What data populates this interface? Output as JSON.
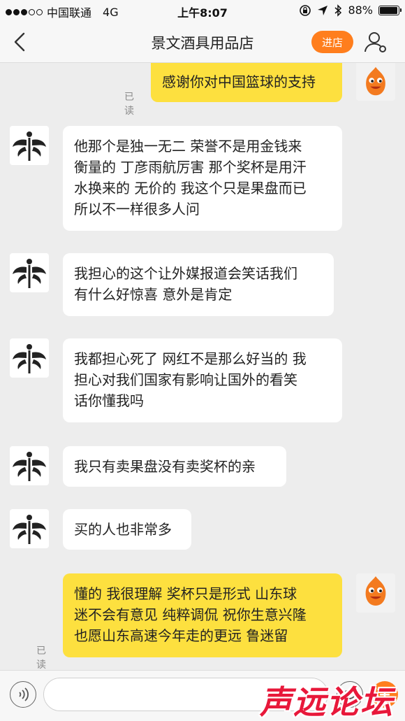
{
  "status_bar": {
    "carrier": "中国联通",
    "network": "4G",
    "time": "上午8:07",
    "battery_text": "88%",
    "battery_level": 0.88
  },
  "header": {
    "title": "景文酒具用品店",
    "enter_store_label": "进店"
  },
  "messages": [
    {
      "sender": "me",
      "lines": [
        "感谢你对中国篮球的支持"
      ],
      "read_label": "已读"
    },
    {
      "sender": "store",
      "lines": [
        "他那个是独一无二 荣誉不是用金钱来",
        "衡量的 丁彦雨航厉害 那个奖杯是用汗",
        "水换来的 无价的 我这个只是果盘而已",
        "所以不一样很多人问"
      ]
    },
    {
      "sender": "store",
      "lines": [
        "我担心的这个让外媒报道会笑话我们",
        "有什么好惊喜 意外是肯定"
      ]
    },
    {
      "sender": "store",
      "lines": [
        "我都担心死了 网红不是那么好当的 我",
        "担心对我们国家有影响让国外的看笑",
        "话你懂我吗"
      ]
    },
    {
      "sender": "store",
      "lines": [
        "我只有卖果盘没有卖奖杯的亲"
      ]
    },
    {
      "sender": "store",
      "lines": [
        "买的人也非常多"
      ]
    },
    {
      "sender": "me",
      "lines": [
        "懂的 我很理解 奖杯只是形式 山东球",
        "迷不会有意见 纯粹调侃 祝你生意兴隆",
        "也愿山东高速今年走的更远 鲁迷留"
      ],
      "read_label": "已读"
    }
  ],
  "input": {
    "placeholder": ""
  },
  "watermark": "声远论坛",
  "colors": {
    "accent": "#ff7e1d",
    "my_bubble": "#fde03f",
    "their_bubble": "#ffffff",
    "background": "#ededed"
  }
}
